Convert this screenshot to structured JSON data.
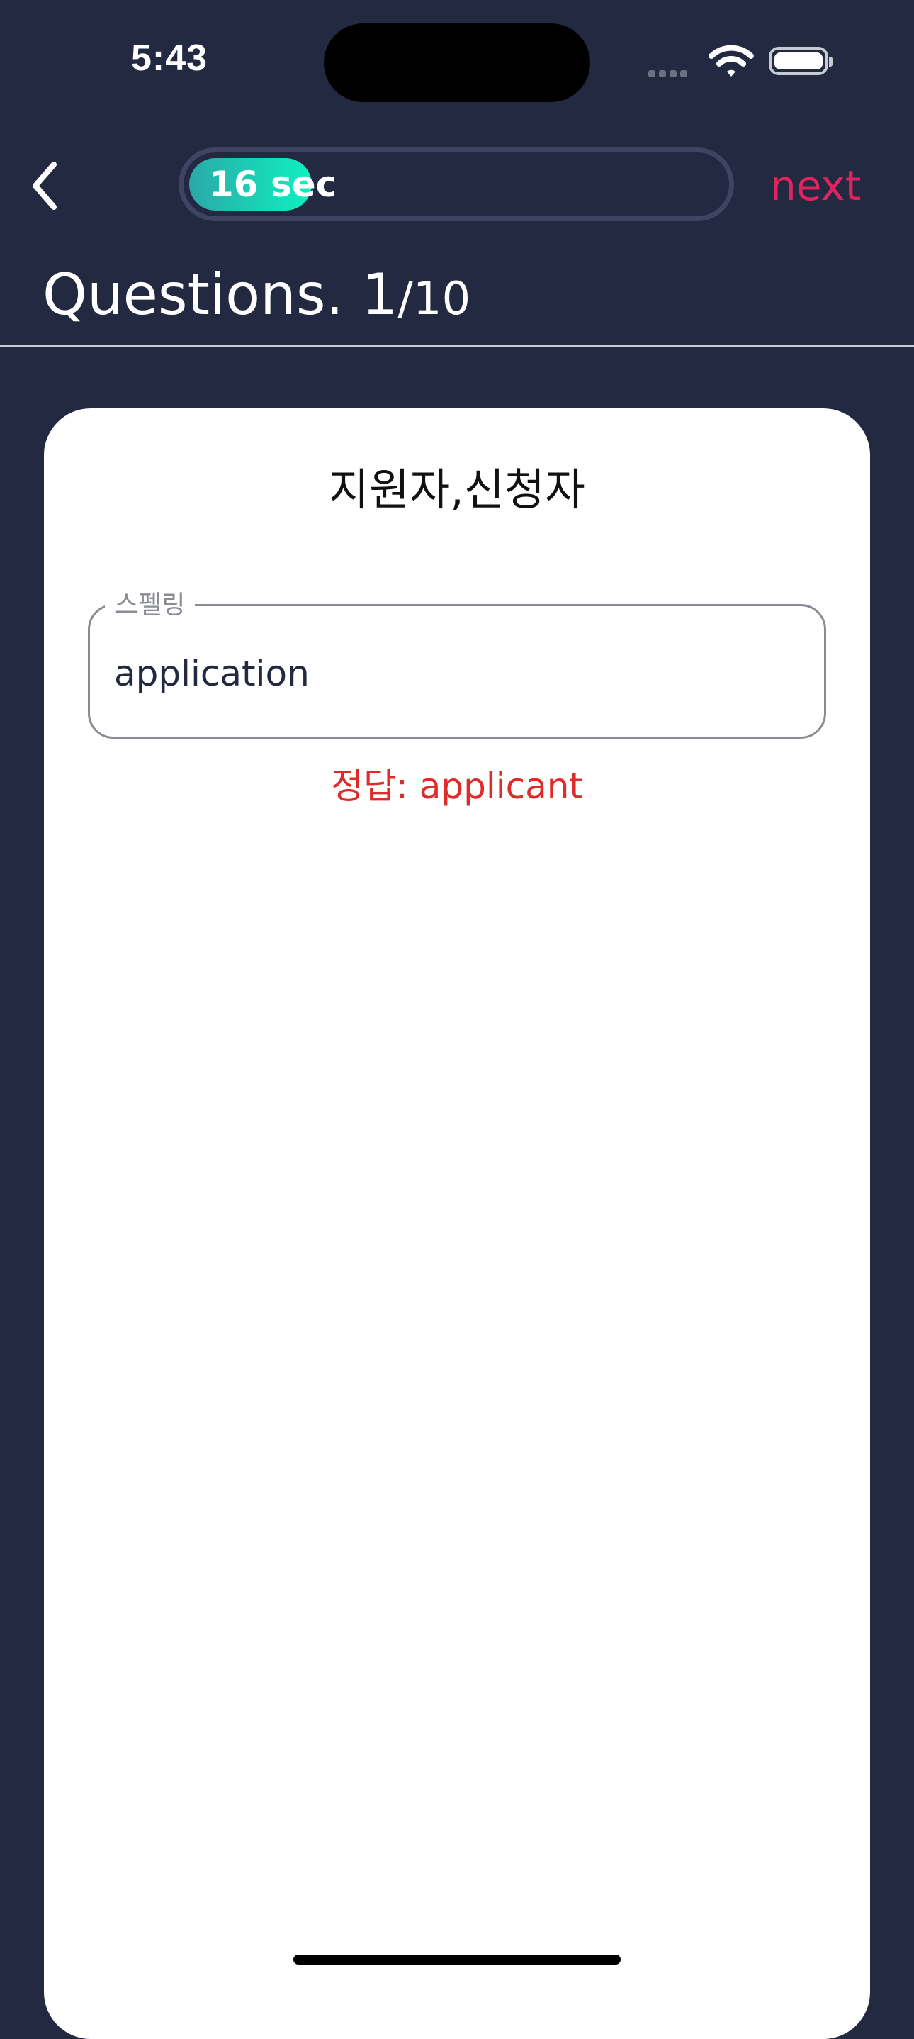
{
  "status_bar": {
    "time": "5:43",
    "icons": [
      "signal-icon",
      "wifi-icon",
      "battery-icon"
    ]
  },
  "header": {
    "back_icon": "chevron-left-icon",
    "timer_text": "16 sec",
    "timer_remaining_fraction": 0.23,
    "next_label": "next"
  },
  "question": {
    "label": "Questions. 1",
    "total": "/10"
  },
  "card": {
    "word": "지원자,신청자",
    "field_label": "스펠링",
    "field_value": "application",
    "answer": "정답: applicant"
  },
  "colors": {
    "background": "#222940",
    "accent_next": "#e0245e",
    "timer_gradient_start": "#2aa9a8",
    "timer_gradient_end": "#0ff0c0",
    "answer": "#e02b2b"
  }
}
